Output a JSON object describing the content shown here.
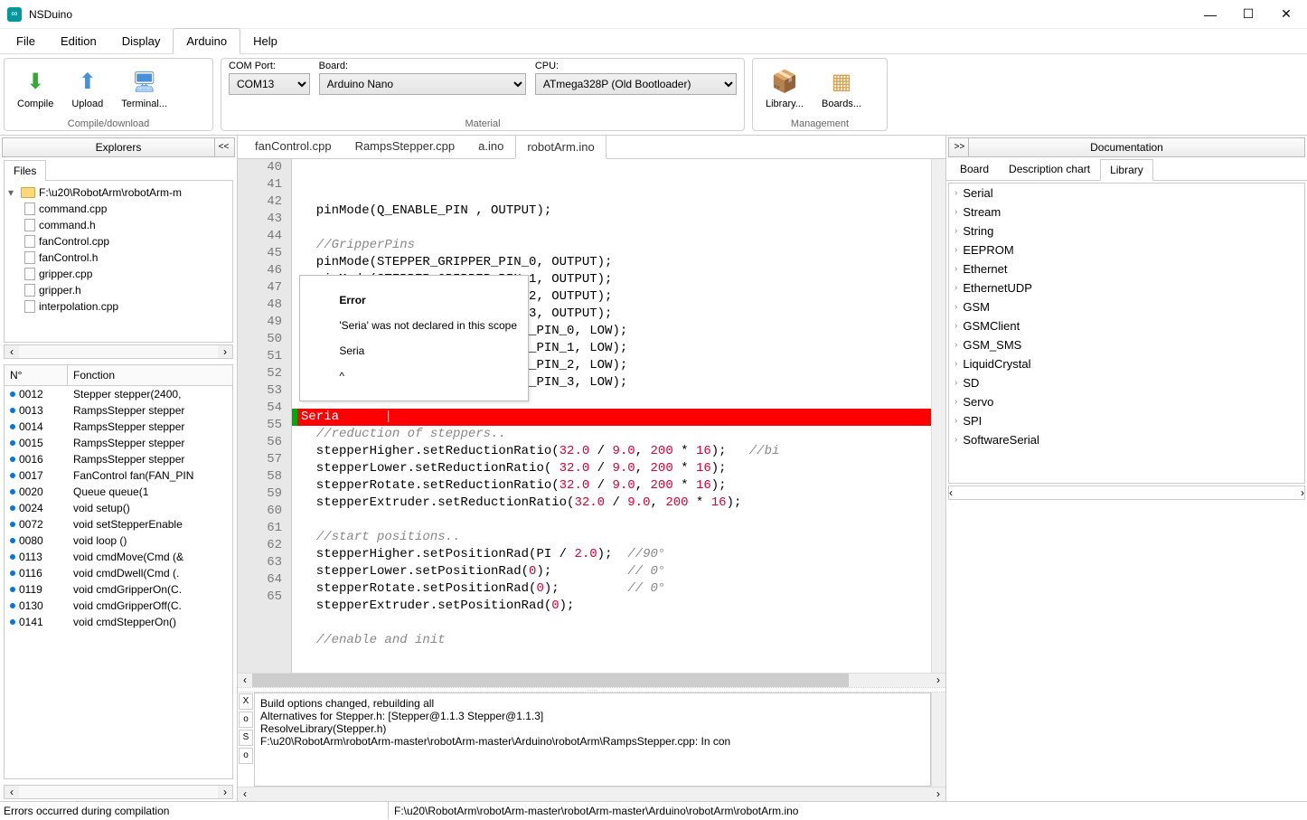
{
  "app": {
    "title": "NSDuino"
  },
  "window_controls": {
    "min": "—",
    "max": "☐",
    "close": "✕"
  },
  "menubar": [
    "File",
    "Edition",
    "Display",
    "Arduino",
    "Help"
  ],
  "menubar_active": 3,
  "ribbon": {
    "compile_group": {
      "title": "Compile/download",
      "buttons": [
        {
          "icon": "compile",
          "label": "Compile"
        },
        {
          "icon": "upload",
          "label": "Upload"
        },
        {
          "icon": "terminal",
          "label": "Terminal..."
        }
      ]
    },
    "material_group": {
      "title": "Material",
      "com_port_label": "COM Port:",
      "com_port_value": "COM13",
      "board_label": "Board:",
      "board_value": "Arduino Nano",
      "cpu_label": "CPU:",
      "cpu_value": "ATmega328P (Old Bootloader)"
    },
    "management_group": {
      "title": "Management",
      "buttons": [
        {
          "icon": "library",
          "label": "Library..."
        },
        {
          "icon": "boards",
          "label": "Boards..."
        }
      ]
    }
  },
  "explorers_title": "Explorers",
  "files_tab": "Files",
  "tree_root": "F:\\u20\\RobotArm\\robotArm-m",
  "tree_files": [
    "command.cpp",
    "command.h",
    "fanControl.cpp",
    "fanControl.h",
    "gripper.cpp",
    "gripper.h",
    "interpolation.cpp"
  ],
  "functions": {
    "col_n": "N°",
    "col_f": "Fonction",
    "rows": [
      {
        "n": "0012",
        "f": "Stepper stepper(2400,"
      },
      {
        "n": "0013",
        "f": "RampsStepper stepper"
      },
      {
        "n": "0014",
        "f": "RampsStepper stepper"
      },
      {
        "n": "0015",
        "f": "RampsStepper stepper"
      },
      {
        "n": "0016",
        "f": "RampsStepper stepper"
      },
      {
        "n": "0017",
        "f": "FanControl fan(FAN_PIN"
      },
      {
        "n": "0020",
        "f": "Queue<Cmd> queue(1"
      },
      {
        "n": "0024",
        "f": "void setup()"
      },
      {
        "n": "0072",
        "f": "void setStepperEnable"
      },
      {
        "n": "0080",
        "f": "void loop ()"
      },
      {
        "n": "0113",
        "f": "void cmdMove(Cmd (&"
      },
      {
        "n": "0116",
        "f": "void cmdDwell(Cmd (."
      },
      {
        "n": "0119",
        "f": "void cmdGripperOn(C."
      },
      {
        "n": "0130",
        "f": "void cmdGripperOff(C."
      },
      {
        "n": "0141",
        "f": "void cmdStepperOn()"
      }
    ]
  },
  "editor_tabs": [
    "fanControl.cpp",
    "RampsStepper.cpp",
    "a.ino",
    "robotArm.ino"
  ],
  "editor_active_tab": 3,
  "code": {
    "first_line": 40,
    "lines": [
      {
        "html": "  pinMode(Q_ENABLE_PIN , OUTPUT);"
      },
      {
        "html": ""
      },
      {
        "html": "  <span class=\"tok-com\">//GripperPins</span>"
      },
      {
        "html": "  pinMode(STEPPER_GRIPPER_PIN_0, OUTPUT);"
      },
      {
        "html": "  pinMode(STEPPER_GRIPPER_PIN_1, OUTPUT);"
      },
      {
        "html": "  pinMode(STEPPER_GRIPPER_PIN_2, OUTPUT);"
      },
      {
        "html": "  pinMode(STEPPER_GRIPPER_PIN_3, OUTPUT);"
      },
      {
        "html": "                            ER_PIN_0, LOW);"
      },
      {
        "html": "                            ER_PIN_1, LOW);"
      },
      {
        "html": "                            ER_PIN_2, LOW);"
      },
      {
        "html": "                            ER_PIN_3, LOW);"
      },
      {
        "html": ""
      },
      {
        "html": "<span class=\"error-green\"></span>Seria      |",
        "error": true
      },
      {
        "html": "  <span class=\"tok-com\">//reduction of steppers..</span>"
      },
      {
        "html": "  stepperHigher.setReductionRatio(<span class=\"tok-num\">32.0</span> / <span class=\"tok-num\">9.0</span>, <span class=\"tok-num\">200</span> * <span class=\"tok-num\">16</span>);   <span class=\"tok-com\">//bi</span>"
      },
      {
        "html": "  stepperLower.setReductionRatio( <span class=\"tok-num\">32.0</span> / <span class=\"tok-num\">9.0</span>, <span class=\"tok-num\">200</span> * <span class=\"tok-num\">16</span>);"
      },
      {
        "html": "  stepperRotate.setReductionRatio(<span class=\"tok-num\">32.0</span> / <span class=\"tok-num\">9.0</span>, <span class=\"tok-num\">200</span> * <span class=\"tok-num\">16</span>);"
      },
      {
        "html": "  stepperExtruder.setReductionRatio(<span class=\"tok-num\">32.0</span> / <span class=\"tok-num\">9.0</span>, <span class=\"tok-num\">200</span> * <span class=\"tok-num\">16</span>);"
      },
      {
        "html": ""
      },
      {
        "html": "  <span class=\"tok-com\">//start positions..</span>"
      },
      {
        "html": "  stepperHigher.setPositionRad(PI / <span class=\"tok-num\">2.0</span>);  <span class=\"tok-com\">//90°</span>"
      },
      {
        "html": "  stepperLower.setPositionRad(<span class=\"tok-num\">0</span>);          <span class=\"tok-com\">// 0°</span>"
      },
      {
        "html": "  stepperRotate.setPositionRad(<span class=\"tok-num\">0</span>);         <span class=\"tok-com\">// 0°</span>"
      },
      {
        "html": "  stepperExtruder.setPositionRad(<span class=\"tok-num\">0</span>);"
      },
      {
        "html": ""
      },
      {
        "html": "  <span class=\"tok-com\">//enable and init</span>"
      }
    ]
  },
  "tooltip": {
    "title": "Error",
    "msg1": "'Seria' was not declared in this scope",
    "msg2": "Seria",
    "caret": "^"
  },
  "console_buttons": [
    "X",
    "o",
    "S",
    "o"
  ],
  "console_lines": [
    "Build options changed, rebuilding all",
    "Alternatives for Stepper.h: [Stepper@1.1.3 Stepper@1.1.3]",
    "ResolveLibrary(Stepper.h)",
    "F:\\u20\\RobotArm\\robotArm-master\\robotArm-master\\Arduino\\robotArm\\RampsStepper.cpp: In con"
  ],
  "documentation_title": "Documentation",
  "doc_tabs": [
    "Board",
    "Description chart",
    "Library"
  ],
  "doc_active_tab": 2,
  "lib_items": [
    "Serial",
    "Stream",
    "String",
    "EEPROM",
    "Ethernet",
    "EthernetUDP",
    "GSM",
    "GSMClient",
    "GSM_SMS",
    "LiquidCrystal",
    "SD",
    "Servo",
    "SPI",
    "SoftwareSerial"
  ],
  "status": {
    "left": "Errors occurred during compilation",
    "right": "F:\\u20\\RobotArm\\robotArm-master\\robotArm-master\\Arduino\\robotArm\\robotArm.ino"
  }
}
